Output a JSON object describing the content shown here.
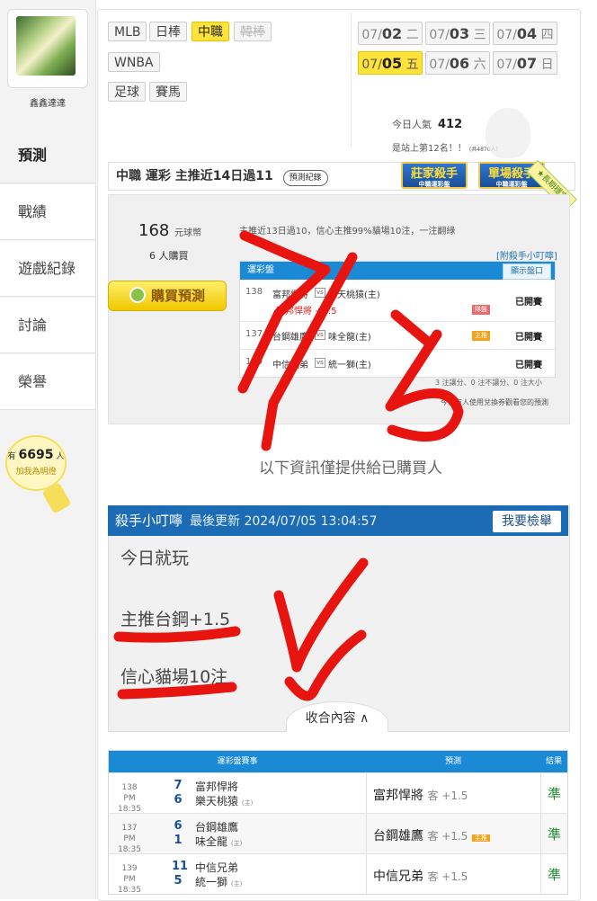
{
  "sidebar": {
    "username": "鑫鑫達達",
    "items": [
      {
        "label": "預測",
        "active": true
      },
      {
        "label": "戰績",
        "active": false
      },
      {
        "label": "遊戲紀錄",
        "active": false
      },
      {
        "label": "討論",
        "active": false
      },
      {
        "label": "榮譽",
        "active": false
      }
    ],
    "fans_prefix": "有",
    "fans_count": "6695",
    "fans_suffix": "人",
    "fans_cta": "加我為明燈"
  },
  "leagues": {
    "row1": [
      "MLB",
      "日棒",
      "中職",
      "韓棒"
    ],
    "row2": [
      "WNBA"
    ],
    "row3": [
      "足球",
      "賽馬"
    ],
    "active": "中職",
    "disabled": "韓棒"
  },
  "dates": [
    {
      "md": "07/",
      "d": "02",
      "w": "二",
      "active": false
    },
    {
      "md": "07/",
      "d": "03",
      "w": "三",
      "active": false
    },
    {
      "md": "07/",
      "d": "04",
      "w": "四",
      "active": false
    },
    {
      "md": "07/",
      "d": "05",
      "w": "五",
      "active": true
    },
    {
      "md": "07/",
      "d": "06",
      "w": "六",
      "active": false
    },
    {
      "md": "07/",
      "d": "07",
      "w": "日",
      "active": false
    }
  ],
  "popularity": {
    "label": "今日人氣",
    "value": "412",
    "rank_text": "是站上第12名！！",
    "rank_sub": "(共4870人)"
  },
  "section": {
    "title": "中職 運彩 主推近14日過11",
    "record_btn": "預測紀錄",
    "badge1": "莊家殺手",
    "badge1_sub": "中職運彩盤",
    "badge2": "單場殺手",
    "badge2_sub": "中職運彩盤",
    "corner": "★長期穩定"
  },
  "purchase": {
    "price": "168",
    "unit": "元球幣",
    "buyers": "6 人購買",
    "summary": "主推近13日過10，信心主推99%貓場10注，一注翻綠",
    "tip_link": "[附殺手小叮嚀]",
    "buy_label": "購買預測",
    "table_header": "運彩盤",
    "open_btn": "顯示盤口",
    "rows": [
      {
        "no": "138",
        "team1": "富邦悍將",
        "team2": "樂天桃猿(主)",
        "line": "富邦悍將 +1.5",
        "chip": "隊盤",
        "result": "已開賽"
      },
      {
        "no": "137",
        "team1": "台鋼雄鷹",
        "team2": "味全龍(主)",
        "line": "",
        "chip": "主推",
        "result": "已開賽"
      },
      {
        "no": "139",
        "team1": "中信兄弟",
        "team2": "統一獅(主)",
        "line": "",
        "chip": "",
        "result": "已開賽"
      }
    ],
    "stats": "3 注讓分、0 注不讓分、0 注大小",
    "viewed": "今日有人使用兌換券觀看您的預測"
  },
  "notice": "以下資訊僅提供給已購買人",
  "tips": {
    "title": "殺手小叮嚀",
    "updated": "最後更新 2024/07/05 13:04:57",
    "report_btn": "我要檢舉",
    "lines": [
      "今日就玩",
      "主推台鋼+1.5",
      "信心貓場10注"
    ],
    "collapse": "收合內容 ∧"
  },
  "results": {
    "headers": [
      "運彩盤賽事",
      "預測",
      "結果"
    ],
    "rows": [
      {
        "no": "138",
        "time": "PM 18:35",
        "s1": "7",
        "s2": "6",
        "team1": "富邦悍將",
        "team2": "樂天桃猿",
        "home": "(主)",
        "pick": "富邦悍將",
        "pick_note": "客 +1.5",
        "chip": "",
        "result": "準"
      },
      {
        "no": "137",
        "time": "PM 18:35",
        "s1": "6",
        "s2": "1",
        "team1": "台鋼雄鷹",
        "team2": "味全龍",
        "home": "(主)",
        "pick": "台鋼雄鷹",
        "pick_note": "客 +1.5",
        "chip": "主推",
        "result": "準"
      },
      {
        "no": "139",
        "time": "PM 18:35",
        "s1": "11",
        "s2": "5",
        "team1": "中信兄弟",
        "team2": "統一獅",
        "home": "(主)",
        "pick": "中信兄弟",
        "pick_note": "客 +1.5",
        "chip": "",
        "result": "準"
      }
    ]
  },
  "handwriting": {
    "text": "7/15",
    "color": "#e8140f"
  }
}
